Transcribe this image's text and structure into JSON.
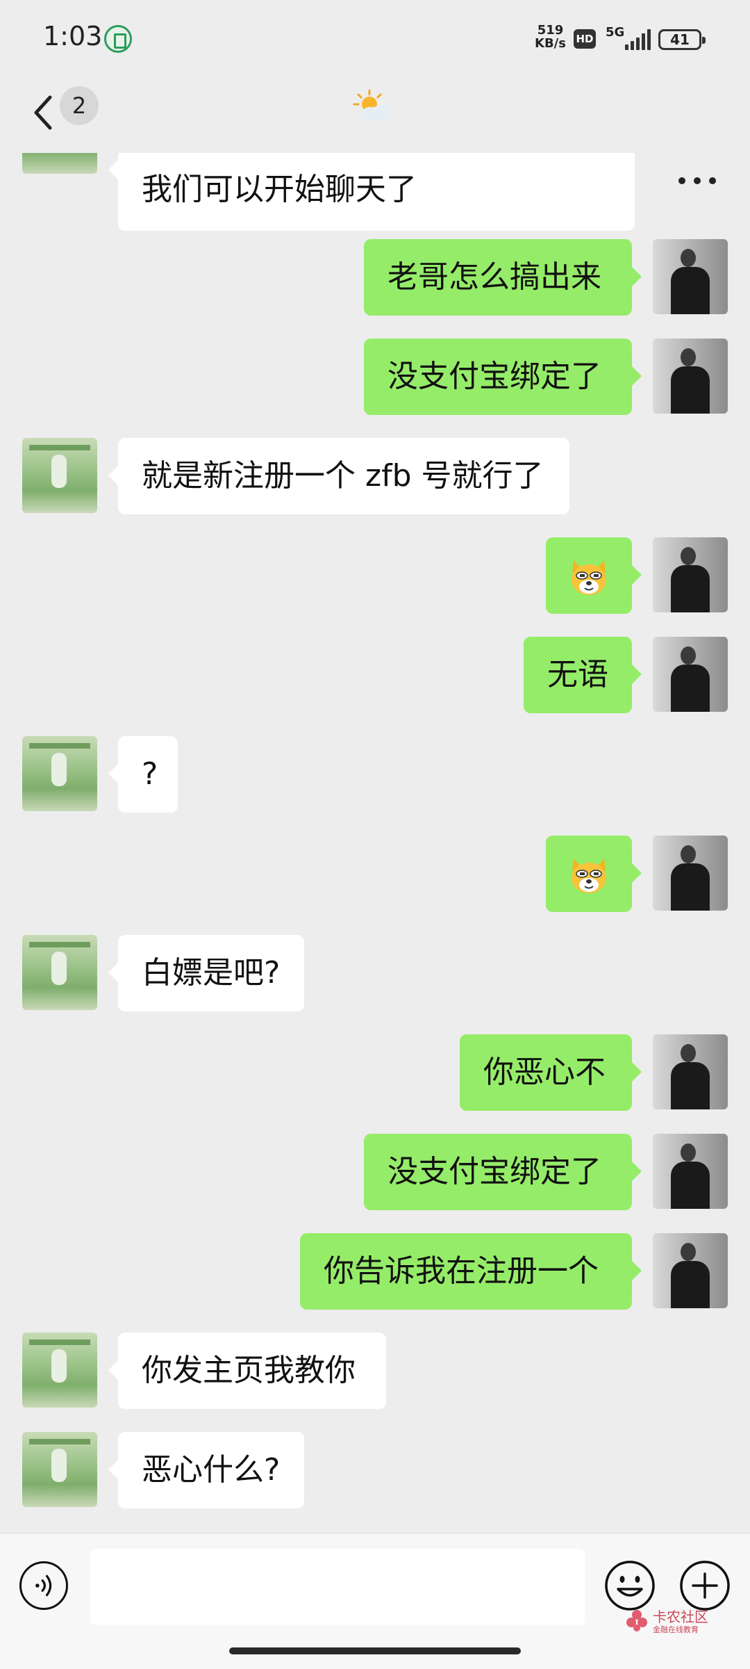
{
  "status_bar": {
    "time": "1:03",
    "net_speed_value": "519",
    "net_speed_unit": "KB/s",
    "hd_label": "HD",
    "network": "5G",
    "battery": "41"
  },
  "nav": {
    "unread_count": "2",
    "title_icon": "sun-cloud-icon"
  },
  "messages": [
    {
      "side": "left",
      "text": "我们可以开始聊天了"
    },
    {
      "side": "right",
      "text": "老哥怎么搞出来"
    },
    {
      "side": "right",
      "text": "没支付宝绑定了"
    },
    {
      "side": "left",
      "text": "就是新注册一个 zfb 号就行了"
    },
    {
      "side": "right",
      "emoji": "dog-face-emoji"
    },
    {
      "side": "right",
      "text": "无语"
    },
    {
      "side": "left",
      "text": "?"
    },
    {
      "side": "right",
      "emoji": "dog-face-emoji"
    },
    {
      "side": "left",
      "text": "白嫖是吧?"
    },
    {
      "side": "right",
      "text": "你恶心不"
    },
    {
      "side": "right",
      "text": "没支付宝绑定了"
    },
    {
      "side": "right",
      "text": "你告诉我在注册一个"
    },
    {
      "side": "left",
      "text": "你发主页我教你"
    },
    {
      "side": "left",
      "text": "恶心什么?"
    }
  ],
  "input_bar": {
    "value": "",
    "placeholder": ""
  },
  "watermark": {
    "title": "卡农社区",
    "subtitle": "金融在线教育"
  },
  "colors": {
    "sent_bubble": "#95ec69",
    "received_bubble": "#ffffff",
    "background": "#ededed"
  }
}
